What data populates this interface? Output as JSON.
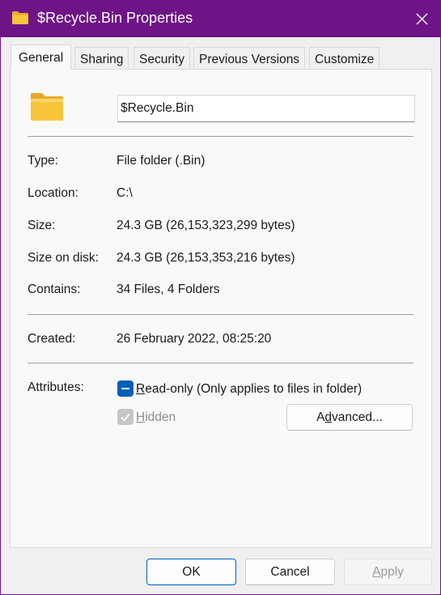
{
  "window": {
    "title": "$Recycle.Bin Properties",
    "accent_color": "#6f1487",
    "icon": "folder-icon",
    "close_icon": "close-icon"
  },
  "tabs": [
    {
      "label": "General",
      "active": true
    },
    {
      "label": "Sharing",
      "active": false
    },
    {
      "label": "Security",
      "active": false
    },
    {
      "label": "Previous Versions",
      "active": false
    },
    {
      "label": "Customize",
      "active": false
    }
  ],
  "general": {
    "name_value": "$Recycle.Bin",
    "properties": [
      {
        "label": "Type:",
        "value": "File folder (.Bin)"
      },
      {
        "label": "Location:",
        "value": "C:\\"
      },
      {
        "label": "Size:",
        "value": "24.3 GB (26,153,323,299 bytes)"
      },
      {
        "label": "Size on disk:",
        "value": "24.3 GB (26,153,353,216 bytes)"
      },
      {
        "label": "Contains:",
        "value": "34 Files, 4 Folders"
      }
    ],
    "created": {
      "label": "Created:",
      "value": "26 February 2022, 08:25:20"
    },
    "attributes": {
      "label": "Attributes:",
      "readonly": {
        "mnemonic": "R",
        "rest": "ead-only (Only applies to files in folder)",
        "state": "indeterminate"
      },
      "hidden": {
        "mnemonic": "H",
        "rest": "idden",
        "state": "checked-disabled"
      },
      "advanced_button": {
        "before": "A",
        "mnemonic": "d",
        "after": "vanced..."
      }
    }
  },
  "footer": {
    "ok_label": "OK",
    "cancel_label": "Cancel",
    "apply_mnemonic": "A",
    "apply_rest": "pply"
  },
  "colors": {
    "accent": "#6f1487",
    "checkbox_blue": "#005fb8",
    "folder_yellow": "#f8c43c"
  }
}
